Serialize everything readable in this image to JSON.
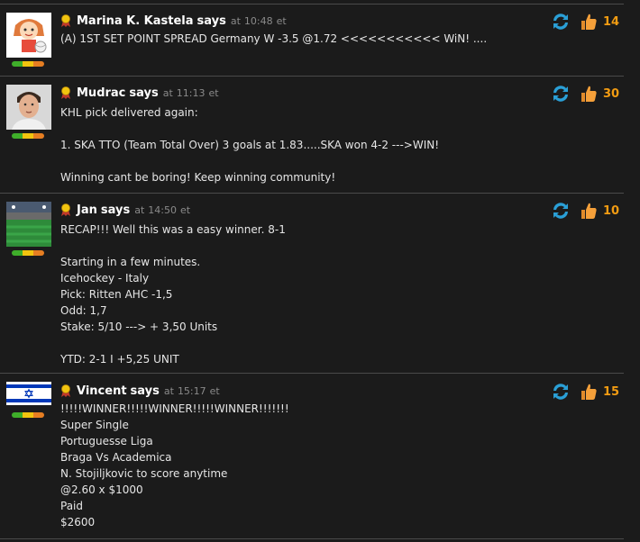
{
  "labels": {
    "says": "says",
    "at": "at",
    "et": "et"
  },
  "colors": {
    "background": "#1b1b1b",
    "count": "#f39c12",
    "refresh": "#2a9fd6",
    "thumb": "#f5a03a"
  },
  "comments": [
    {
      "author": "Marina K. Kastela",
      "time": "10:48",
      "likes": "14",
      "avatar": "volleyball-girl-cartoon",
      "lines": [
        "(A) 1ST SET POINT SPREAD Germany W -3.5 @1.72 <<<<<<<<<<< WiN! ...."
      ]
    },
    {
      "author": "Mudrac",
      "time": "11:13",
      "likes": "30",
      "avatar": "man-portrait-photo",
      "lines": [
        "KHL pick delivered again:",
        "",
        "1. SKA TTO (Team Total Over) 3 goals at 1.83.....SKA won 4-2 --->WIN!",
        "",
        "Winning cant be boring! Keep winning community!"
      ]
    },
    {
      "author": "Jan",
      "time": "14:50",
      "likes": "10",
      "avatar": "stadium-photo",
      "lines": [
        "RECAP!!! Well this was a easy winner. 8-1",
        "",
        "Starting in a few minutes.",
        "Icehockey - Italy",
        "Pick: Ritten AHC -1,5",
        "Odd: 1,7",
        "Stake: 5/10 ---> + 3,50 Units",
        "",
        "YTD: 2-1 I +5,25 UNIT"
      ]
    },
    {
      "author": "Vincent",
      "time": "15:17",
      "likes": "15",
      "avatar": "israel-flag",
      "lines": [
        "!!!!!WINNER!!!!!WINNER!!!!!WINNER!!!!!!!",
        "Super Single",
        "Portuguesse Liga",
        "Braga Vs Academica",
        "N. Stojiljkovic to score anytime",
        "@2.60 x $1000",
        "Paid",
        "$2600"
      ]
    }
  ]
}
